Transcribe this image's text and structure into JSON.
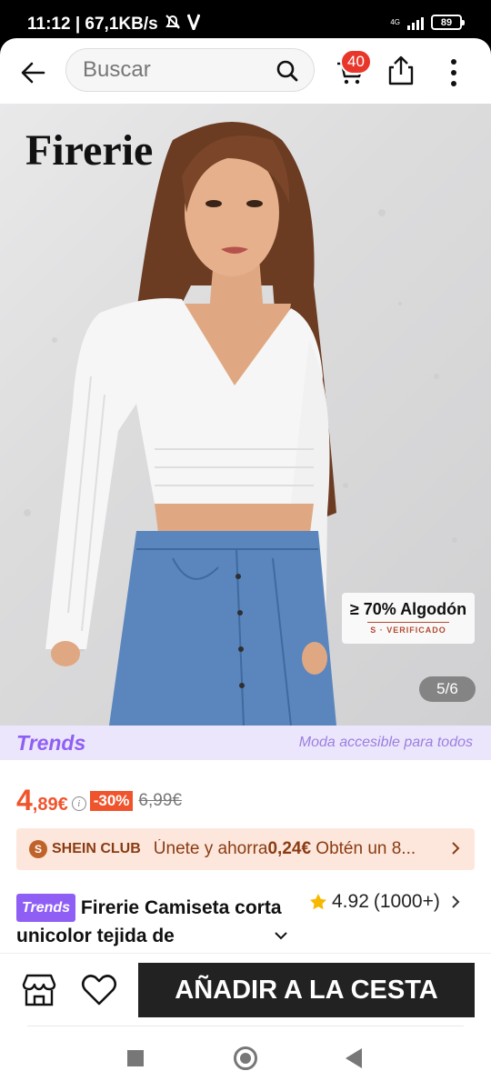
{
  "status_bar": {
    "time_speed": "11:12 | 67,1KB/s",
    "network": "4G",
    "battery": "89"
  },
  "search": {
    "placeholder": "Buscar"
  },
  "cart": {
    "badge_count": "40"
  },
  "hero": {
    "brand": "Firerie",
    "cotton_label": "≥ 70% Algodón",
    "verified_label": "S · VERIFICADO",
    "image_counter": "5/6"
  },
  "trends_band": {
    "logo": "Trends",
    "tagline": "Moda accesible para todos"
  },
  "price": {
    "main": "4",
    "decimal": ",89€",
    "info_symbol": "i",
    "discount": "-30%",
    "original": "6,99€"
  },
  "club": {
    "badge": "S",
    "name": "SHEIN CLUB",
    "text_prefix": "Únete y ahorra",
    "saving": "0,24€",
    "text_suffix": " Obtén un 8..."
  },
  "product": {
    "chip": "Trends",
    "title": "Firerie Camiseta corta unicolor tejida de",
    "rating": "4.92",
    "reviews": "(1000+)"
  },
  "actions": {
    "add_to_cart": "AÑADIR A LA CESTA"
  },
  "colors": {
    "accent": "#f0542d",
    "trends_purple": "#8f5ff5",
    "club_bg": "#fde7dc",
    "button_dark": "#222222"
  }
}
